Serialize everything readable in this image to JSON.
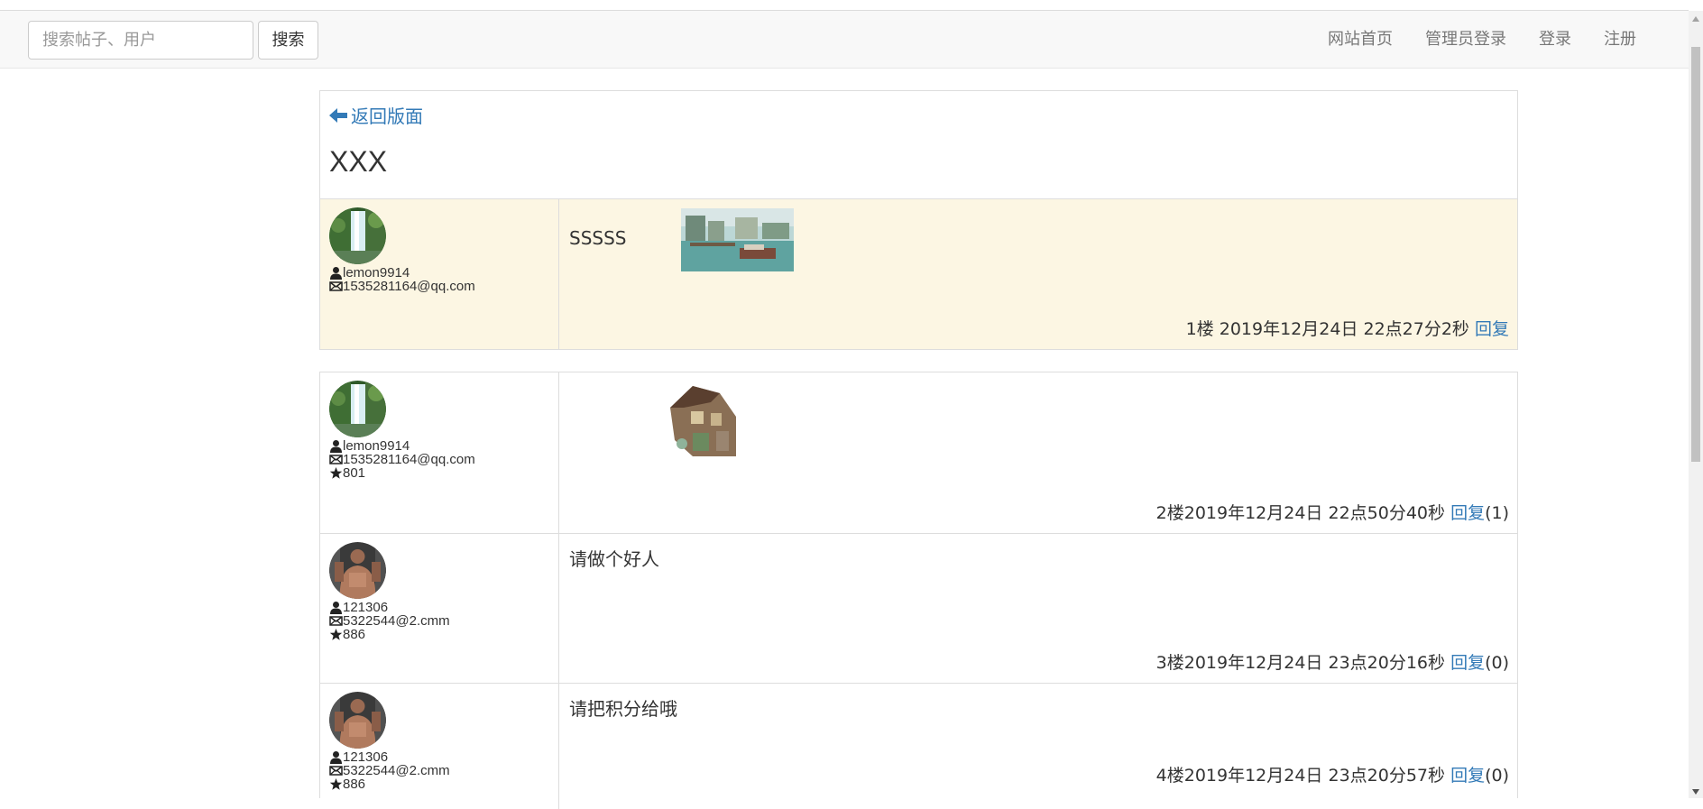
{
  "search": {
    "placeholder": "搜索帖子、用户",
    "button": "搜索"
  },
  "nav": {
    "home": "网站首页",
    "admin_login": "管理员登录",
    "login": "登录",
    "register": "注册"
  },
  "thread": {
    "back_label": "返回版面",
    "title": "XXX"
  },
  "main_post": {
    "username": "lemon9914",
    "email": "1535281164@qq.com",
    "content": "SSSSS",
    "meta": "1楼 2019年12月24日 22点27分2秒",
    "reply_label": "回复"
  },
  "replies": [
    {
      "username": "lemon9914",
      "email": "1535281164@qq.com",
      "points": "801",
      "content": "",
      "meta": "2楼2019年12月24日 22点50分40秒",
      "reply_label": "回复",
      "reply_count": "(1)"
    },
    {
      "username": "121306",
      "email": "5322544@2.cmm",
      "points": "886",
      "content": "请做个好人",
      "meta": "3楼2019年12月24日 23点20分16秒",
      "reply_label": "回复",
      "reply_count": "(0)"
    },
    {
      "username": "121306",
      "email": "5322544@2.cmm",
      "points": "886",
      "content": "请把积分给哦",
      "meta": "4楼2019年12月24日 23点20分57秒",
      "reply_label": "回复",
      "reply_count": "(0)"
    }
  ],
  "icons": {
    "user": "user-icon",
    "mail": "envelope-icon",
    "points": "star-icon",
    "back": "arrow-left-icon"
  },
  "colors": {
    "link": "#337ab7",
    "highlight_row": "#fcf8e3"
  }
}
